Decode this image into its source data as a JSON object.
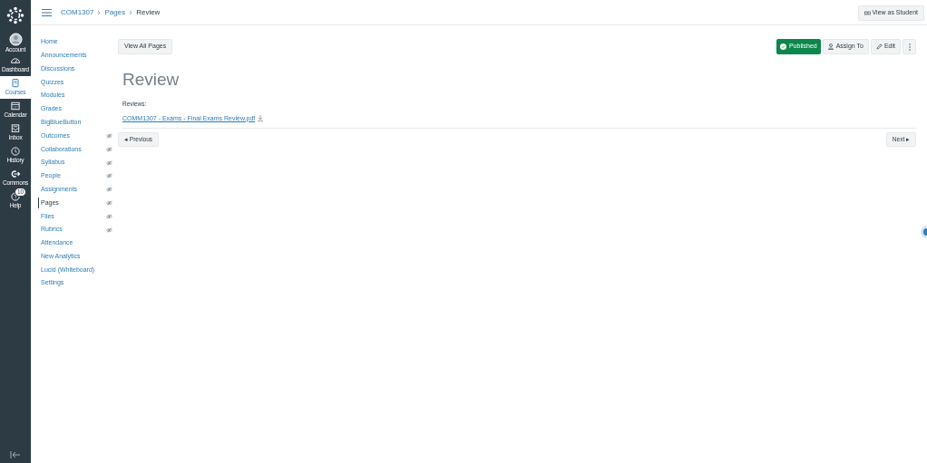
{
  "global_nav": [
    {
      "label": "Account",
      "selected": false
    },
    {
      "label": "Dashboard",
      "selected": false
    },
    {
      "label": "Courses",
      "selected": true
    },
    {
      "label": "Calendar",
      "selected": false
    },
    {
      "label": "Inbox",
      "selected": false
    },
    {
      "label": "History",
      "selected": false
    },
    {
      "label": "Commons",
      "selected": false
    },
    {
      "label": "Help",
      "selected": false,
      "badge": "10"
    }
  ],
  "breadcrumbs": [
    {
      "label": "COM1307",
      "link": true
    },
    {
      "label": "Pages",
      "link": true
    },
    {
      "label": "Review",
      "link": false
    }
  ],
  "view_as_student": "View as Student",
  "course_nav": [
    {
      "label": "Home",
      "selected": false,
      "hidden": false
    },
    {
      "label": "Announcements",
      "selected": false,
      "hidden": false
    },
    {
      "label": "Discussions",
      "selected": false,
      "hidden": false
    },
    {
      "label": "Quizzes",
      "selected": false,
      "hidden": false
    },
    {
      "label": "Modules",
      "selected": false,
      "hidden": false
    },
    {
      "label": "Grades",
      "selected": false,
      "hidden": false
    },
    {
      "label": "BigBlueButton",
      "selected": false,
      "hidden": false
    },
    {
      "label": "Outcomes",
      "selected": false,
      "hidden": true
    },
    {
      "label": "Collaborations",
      "selected": false,
      "hidden": true
    },
    {
      "label": "Syllabus",
      "selected": false,
      "hidden": true
    },
    {
      "label": "People",
      "selected": false,
      "hidden": true
    },
    {
      "label": "Assignments",
      "selected": false,
      "hidden": true
    },
    {
      "label": "Pages",
      "selected": true,
      "hidden": true
    },
    {
      "label": "Files",
      "selected": false,
      "hidden": true
    },
    {
      "label": "Rubrics",
      "selected": false,
      "hidden": true
    },
    {
      "label": "Attendance",
      "selected": false,
      "hidden": false
    },
    {
      "label": "New Analytics",
      "selected": false,
      "hidden": false
    },
    {
      "label": "Lucid (Whiteboard)",
      "selected": false,
      "hidden": false
    },
    {
      "label": "Settings",
      "selected": false,
      "hidden": false
    }
  ],
  "toolbar": {
    "view_all": "View All Pages",
    "published": {
      "label": "Published",
      "on": true
    },
    "assign": "Assign To",
    "edit": "Edit"
  },
  "page": {
    "title": "Review",
    "label": "Reviews:",
    "file_link": "COMM1307 - Exams - Final Exams Review.pdf"
  },
  "pager": {
    "previous": "◂ Previous",
    "next": "Next ▸"
  }
}
